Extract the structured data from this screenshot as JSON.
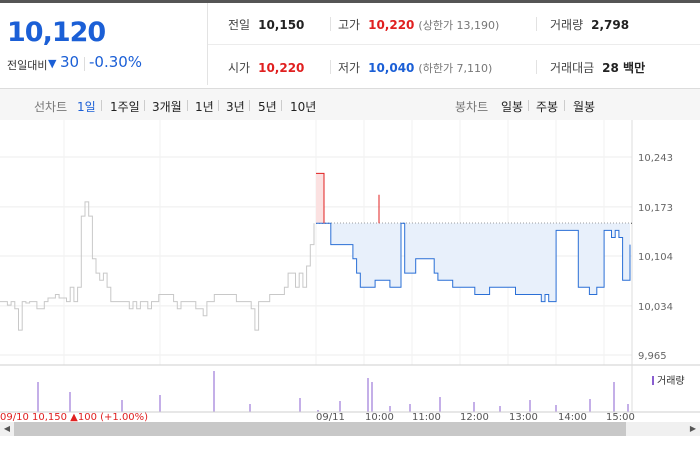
{
  "header": {
    "price": "10,120",
    "change_label": "전일대비",
    "change_arrow": "▼",
    "change_value": "30",
    "change_pct": "-0.30%"
  },
  "stats": {
    "prev_close": {
      "label": "전일",
      "value": "10,150"
    },
    "high": {
      "label": "고가",
      "value": "10,220",
      "sub": "(상한가 13,190)"
    },
    "volume": {
      "label": "거래량",
      "value": "2,798"
    },
    "open": {
      "label": "시가",
      "value": "10,220"
    },
    "low": {
      "label": "저가",
      "value": "10,040",
      "sub": "(하한가 7,110)"
    },
    "turnover": {
      "label": "거래대금",
      "value": "28 백만"
    }
  },
  "line_tabs": {
    "label": "선차트",
    "items": [
      "1일",
      "1주일",
      "3개월",
      "1년",
      "3년",
      "5년",
      "10년"
    ],
    "selected": "1일"
  },
  "candle_tabs": {
    "label": "봉차트",
    "items": [
      "일봉",
      "주봉",
      "월봉"
    ]
  },
  "chart": {
    "y_ticks": [
      "10,243",
      "10,173",
      "10,104",
      "10,034",
      "9,965"
    ],
    "volume_legend": "거래량",
    "x_labels": [
      "09/10 10,150 ▲100 (+1.00%)",
      "09/11",
      "10:00",
      "11:00",
      "12:00",
      "13:00",
      "14:00",
      "15:00"
    ],
    "colors": {
      "history": "#c8c8c8",
      "today": "#2a6fd6",
      "fill": "#e8f0fb",
      "up": "#e02020",
      "volume": "#8a5fd0"
    }
  },
  "chart_data": {
    "type": "line",
    "ylim": [
      9965,
      10243
    ],
    "yticks": [
      10243,
      10173,
      10104,
      10034,
      9965
    ],
    "prev_close": 10150,
    "series": [
      {
        "values": [
          10040,
          10040,
          10035,
          10040,
          10030,
          10000,
          10040,
          10038,
          10040,
          10040,
          10030,
          10030,
          10040,
          10045,
          10045,
          10050,
          10045,
          10045,
          10040,
          10060,
          10040,
          10060,
          10160,
          10180,
          10160,
          10100,
          10080,
          10070,
          10080,
          10060,
          10040,
          10040,
          10040,
          10040,
          10040,
          10030,
          10040,
          10030,
          10040,
          10040,
          10030,
          10040,
          10040,
          10050,
          10050,
          10050,
          10050,
          10040,
          10030,
          10040,
          10040,
          10040,
          10040,
          10030,
          10030,
          10020,
          10040,
          10040,
          10050,
          10050,
          10050,
          10050,
          10050,
          10050,
          10040,
          10040,
          10040,
          10040,
          10030,
          10000,
          10040,
          10040,
          10040,
          10050,
          10050,
          10050,
          10050,
          10060,
          10080,
          10080,
          10060,
          10080,
          10060,
          10090,
          10120,
          10150
        ]
      },
      {
        "values": [
          10150,
          10150,
          10150,
          10150,
          10120,
          10120,
          10120,
          10120,
          10120,
          10120,
          10100,
          10080,
          10060,
          10060,
          10060,
          10060,
          10070,
          10070,
          10070,
          10070,
          10060,
          10060,
          10060,
          10150,
          10080,
          10080,
          10080,
          10100,
          10100,
          10100,
          10100,
          10100,
          10080,
          10070,
          10070,
          10070,
          10070,
          10060,
          10060,
          10060,
          10060,
          10060,
          10060,
          10050,
          10050,
          10050,
          10050,
          10060,
          10060,
          10060,
          10060,
          10060,
          10060,
          10060,
          10050,
          10050,
          10050,
          10050,
          10050,
          10050,
          10050,
          10040,
          10050,
          10040,
          10040,
          10140,
          10140,
          10140,
          10140,
          10140,
          10140,
          10060,
          10060,
          10060,
          10050,
          10050,
          10060,
          10060,
          10140,
          10140,
          10130,
          10140,
          10130,
          10070,
          10070,
          10120
        ]
      }
    ]
  }
}
